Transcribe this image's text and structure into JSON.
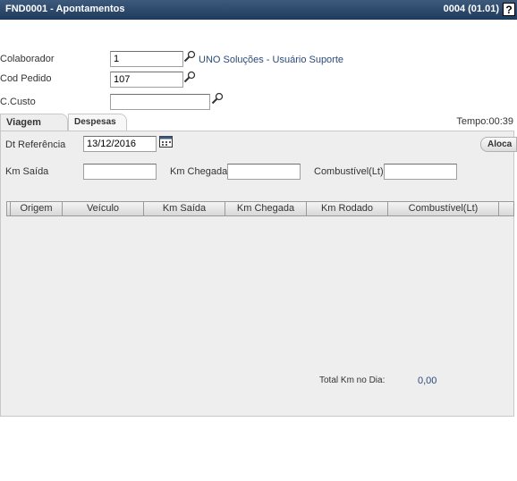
{
  "window": {
    "title": "FND0001 - Apontamentos",
    "code": "0004 (01.01)",
    "help_glyph": "?"
  },
  "form": {
    "colaborador_label": "Colaborador",
    "colaborador_value": "1",
    "colaborador_name": "UNO Soluções - Usuário Suporte",
    "cod_pedido_label": "Cod Pedido",
    "cod_pedido_value": "107",
    "ccusto_label": "C.Custo",
    "ccusto_value": ""
  },
  "tabs": [
    {
      "label": "Viagem",
      "active": true
    },
    {
      "label": "Despesas",
      "active": false
    }
  ],
  "tempo": "Tempo:00:39",
  "viagem": {
    "dt_ref_label": "Dt Referência",
    "dt_ref_value": "13/12/2016",
    "aloca_label": "Aloca",
    "km_saida_label": "Km Saída",
    "km_saida_value": "",
    "km_chegada_label": "Km Chegada",
    "km_chegada_value": "",
    "combustivel_label": "Combustível(Lt)",
    "combustivel_value": "",
    "columns": [
      "",
      "Origem",
      "Veículo",
      "Km Saída",
      "Km Chegada",
      "Km Rodado",
      "Combustível(Lt)",
      ""
    ],
    "rows": [],
    "total_label": "Total Km no Dia:",
    "total_value": "0,00"
  },
  "colors": {
    "titlebar": "#2b4a6e",
    "panel": "#eeeeee",
    "link": "#2a4a7a"
  }
}
